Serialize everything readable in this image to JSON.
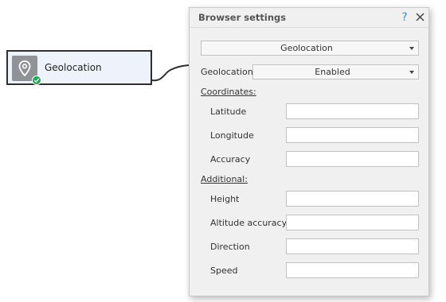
{
  "node": {
    "label": "Geolocation",
    "icon": "map-pin-icon",
    "status_icon": "check-icon",
    "status_color": "#25a35a"
  },
  "panel": {
    "title": "Browser settings",
    "help_icon": "?",
    "close_icon": "close-icon",
    "mode_select": {
      "selected": "Geolocation"
    },
    "geolocation": {
      "label": "Geolocation",
      "selected": "Enabled"
    },
    "coordinates": {
      "title": "Coordinates:",
      "fields": [
        {
          "label": "Latitude",
          "value": ""
        },
        {
          "label": "Longitude",
          "value": ""
        },
        {
          "label": "Accuracy",
          "value": ""
        }
      ]
    },
    "additional": {
      "title": "Additional:",
      "fields": [
        {
          "label": "Height",
          "value": ""
        },
        {
          "label": "Altitude accuracy",
          "value": ""
        },
        {
          "label": "Direction",
          "value": ""
        },
        {
          "label": "Speed",
          "value": ""
        }
      ]
    }
  },
  "colors": {
    "accent": "#3b8fd9",
    "panel_bg": "#f0f0f0",
    "node_bg": "#eef3fb"
  }
}
